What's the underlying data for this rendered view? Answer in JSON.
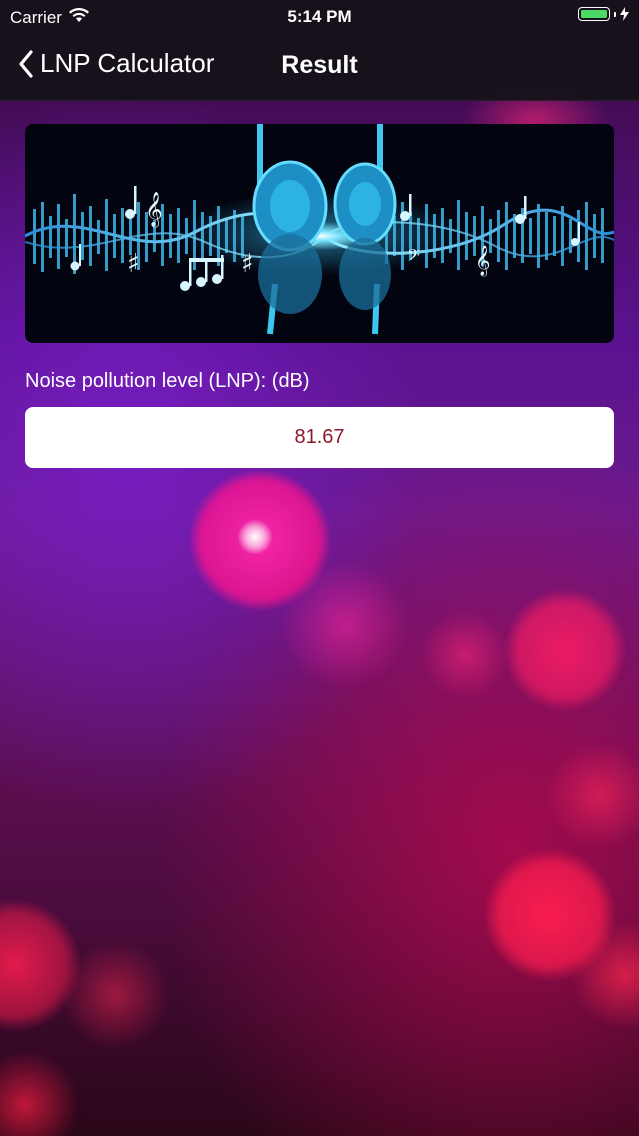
{
  "status_bar": {
    "carrier": "Carrier",
    "time": "5:14 PM",
    "wifi_icon": "wifi-icon",
    "battery_icon": "battery-charging-icon",
    "battery_color": "#4cd964"
  },
  "nav": {
    "back_label": "LNP Calculator",
    "title": "Result"
  },
  "main": {
    "banner_image": "headphones-music-wave-banner",
    "result_label": "Noise pollution level (LNP): (dB)",
    "result_value": "81.67",
    "result_color": "#8b1a2c"
  }
}
